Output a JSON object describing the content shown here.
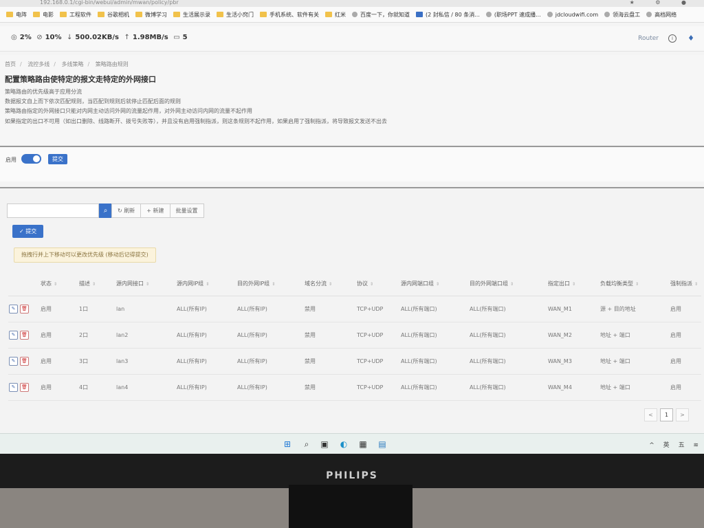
{
  "browser": {
    "url": "192.168.0.1/cgi-bin/webui/admin/mwan/policy/pbr",
    "bookmarks": [
      {
        "label": "电阵",
        "icon": "folder-icon"
      },
      {
        "label": "电影",
        "icon": "folder-icon"
      },
      {
        "label": "工程软件",
        "icon": "folder-icon"
      },
      {
        "label": "谷歌相机",
        "icon": "folder-icon"
      },
      {
        "label": "微博学习",
        "icon": "folder-icon"
      },
      {
        "label": "生活展示录",
        "icon": "folder-icon"
      },
      {
        "label": "生活小窍门",
        "icon": "folder-icon"
      },
      {
        "label": "手机系统、软件有关",
        "icon": "folder-icon"
      },
      {
        "label": "红米",
        "icon": "folder-icon"
      },
      {
        "label": "百度一下，你就知道",
        "icon": "globe-icon"
      },
      {
        "label": "(2 封私信 / 80 条消...",
        "icon": "zhihu-icon"
      },
      {
        "label": "(职场PPT 速成播...",
        "icon": "bilibili-icon"
      },
      {
        "label": "jdcloudwifi.com",
        "icon": "jd-icon"
      },
      {
        "label": "领海云盘工",
        "icon": "cloud-icon"
      },
      {
        "label": "高档网络",
        "icon": "page-icon"
      }
    ]
  },
  "statusbar": {
    "cpu": "2%",
    "mem": "10%",
    "down": "500.02KB/s",
    "up": "1.98MB/s",
    "devices": "5",
    "router_label": "Router"
  },
  "page": {
    "breadcrumb": [
      "首页",
      "流控多线",
      "多线策略",
      "策略路由规则"
    ],
    "title": "配置策略路由使特定的报文走特定的外网接口",
    "desc": [
      "策略路由的优先级高于应用分流",
      "数据报文自上而下依次匹配规则，当匹配到规则后就停止匹配后面的规则",
      "策略路由指定的外网接口只能对内网主动访问外网的流量起作用，对外网主动访问内网的流量不起作用",
      "如果指定的出口不可用（如出口删除、线路断开、拨号失败等），并且没有启用强制指派，则这条规则不起作用，如果启用了强制指派，将导致报文发送不出去"
    ],
    "enable_label": "启用",
    "enable_on": true,
    "submit_label": "提交"
  },
  "rules": {
    "search_placeholder": "",
    "refresh_label": "刷新",
    "new_label": "+ 新建",
    "batch_label": "批量设置",
    "submit_label": "✓ 提交",
    "hint": "拖拽行并上下移动可以更改优先级 (移动后记得提交)",
    "columns": [
      "状态",
      "描述",
      "源内网接口",
      "源内网IP组",
      "目的外网IP组",
      "域名分流",
      "协议",
      "源内网端口组",
      "目的外网端口组",
      "指定出口",
      "负载均衡类型",
      "强制指派"
    ],
    "rows": [
      [
        "启用",
        "1口",
        "lan",
        "ALL(所有IP)",
        "ALL(所有IP)",
        "禁用",
        "TCP+UDP",
        "ALL(所有端口)",
        "ALL(所有端口)",
        "WAN_M1",
        "源 + 目的地址",
        "启用"
      ],
      [
        "启用",
        "2口",
        "lan2",
        "ALL(所有IP)",
        "ALL(所有IP)",
        "禁用",
        "TCP+UDP",
        "ALL(所有端口)",
        "ALL(所有端口)",
        "WAN_M2",
        "地址 + 端口",
        "启用"
      ],
      [
        "启用",
        "3口",
        "lan3",
        "ALL(所有IP)",
        "ALL(所有IP)",
        "禁用",
        "TCP+UDP",
        "ALL(所有端口)",
        "ALL(所有端口)",
        "WAN_M3",
        "地址 + 端口",
        "启用"
      ],
      [
        "启用",
        "4口",
        "lan4",
        "ALL(所有IP)",
        "ALL(所有IP)",
        "禁用",
        "TCP+UDP",
        "ALL(所有端口)",
        "ALL(所有端口)",
        "WAN_M4",
        "地址 + 端口",
        "启用"
      ]
    ],
    "pagination": {
      "prev": "<",
      "current": "1",
      "next": ">"
    }
  },
  "taskbar": {
    "apps": [
      "windows-start-icon",
      "search-icon",
      "taskview-icon",
      "edge-icon",
      "calculator-icon",
      "remote-desktop-icon"
    ],
    "tray": [
      "^",
      "英",
      "五"
    ]
  },
  "monitor": {
    "brand": "PHILIPS"
  },
  "colors": {
    "accent": "#3a72c9",
    "hint_bg": "#fbf3dc",
    "taskbar": "#e9f0ee"
  }
}
